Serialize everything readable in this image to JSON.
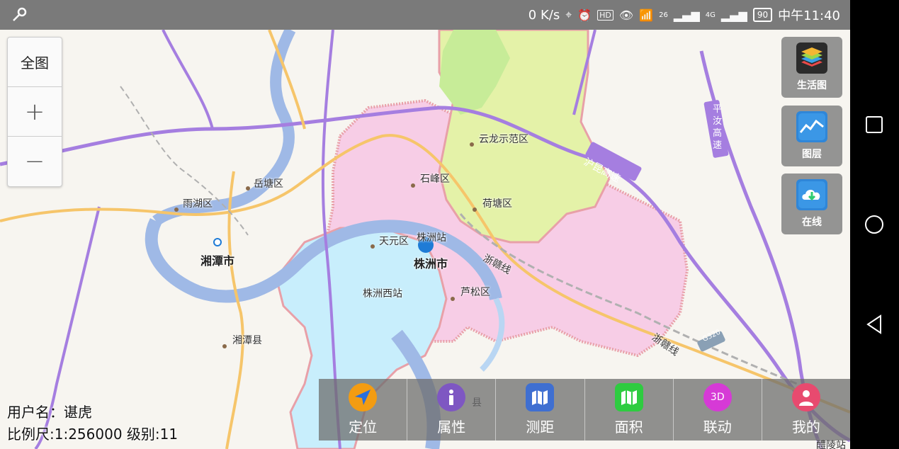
{
  "status_bar": {
    "speed": "0 K/s",
    "network1": "26",
    "network2": "4G",
    "battery": "90",
    "time": "中午11:40"
  },
  "zoom": {
    "full_label": "全图",
    "in_label": "+",
    "out_label": "−"
  },
  "side_buttons": [
    {
      "label": "生活图",
      "icon": "layers-stack-icon"
    },
    {
      "label": "图层",
      "icon": "layer-chart-icon"
    },
    {
      "label": "在线",
      "icon": "cloud-download-icon"
    }
  ],
  "map_labels": {
    "yunlong": "云龙示范区",
    "shifeng": "石峰区",
    "hetang": "荷塘区",
    "tianyuan": "天元区",
    "zhuzhou_station": "株洲站",
    "zhuzhou_city": "株洲市",
    "zhuzhou_west": "株洲西站",
    "lusong": "芦松区",
    "yuhu": "雨湖区",
    "yuetang": "岳塘区",
    "xiangtan_city": "湘潭市",
    "xiangtan_county": "湘潭县",
    "hukun": "沪昆高速",
    "pingru": "平汝高速",
    "zhegan1": "浙赣线",
    "zhegan2": "浙赣线",
    "g320": "G320",
    "xian": "县",
    "liling": "醴陵站"
  },
  "toolbar": [
    {
      "label": "定位",
      "icon": "locate-arrow-icon",
      "color": "#f39c12"
    },
    {
      "label": "属性",
      "icon": "info-icon",
      "color": "#7e57c2"
    },
    {
      "label": "测距",
      "icon": "measure-map-icon",
      "color": "#3f6fd1"
    },
    {
      "label": "面积",
      "icon": "area-map-icon",
      "color": "#2ecc40"
    },
    {
      "label": "联动",
      "icon": "3d-icon",
      "color": "#d63ad6",
      "badge": "3D"
    },
    {
      "label": "我的",
      "icon": "user-icon",
      "color": "#e84a6f"
    }
  ],
  "user_info": {
    "username": "用户名：谌虎",
    "scale": "比例尺:1:256000 级别:11"
  }
}
